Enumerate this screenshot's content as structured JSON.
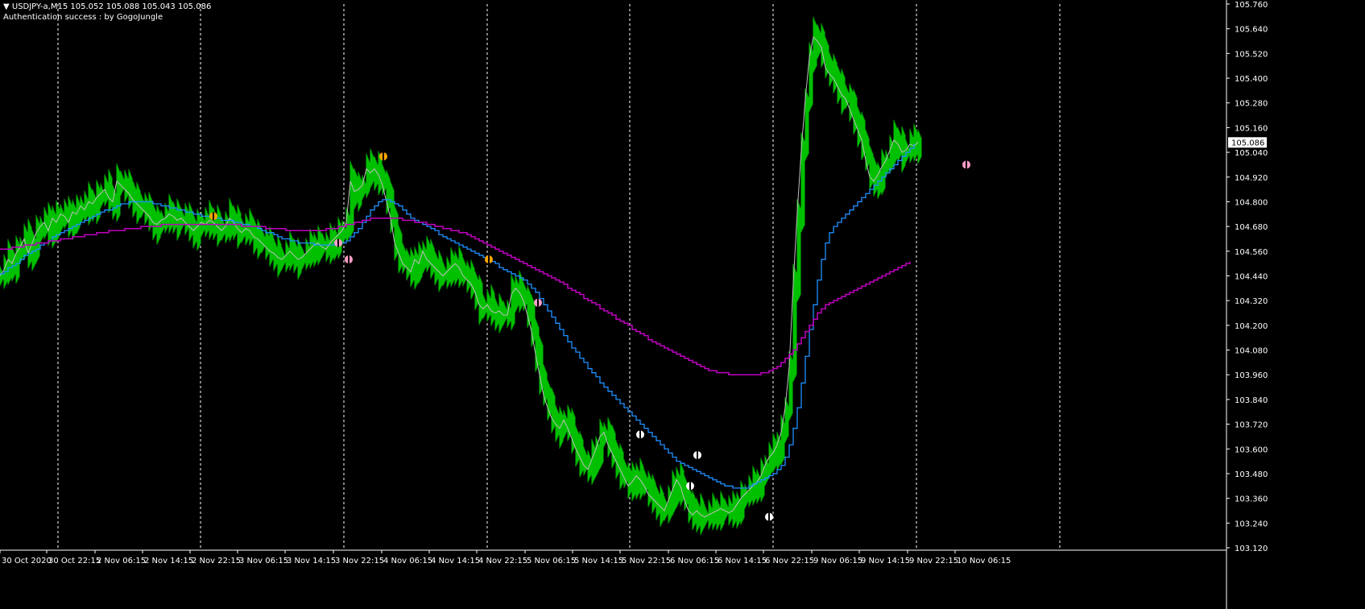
{
  "header": {
    "symbol_line": "▼ USDJPY-a,M15  105.052 105.088 105.043 105.086",
    "auth_line": "Authentication success : by GogoJungle"
  },
  "colors": {
    "background": "#000000",
    "price_bars": "#00c000",
    "ma_fast": "#c0c0c0",
    "ma_mid": "#1e90ff",
    "ma_slow": "#c000c0",
    "axis": "#ffffff",
    "signal_orange": "#ffa500",
    "signal_pink": "#ff9ec8",
    "signal_white": "#ffffff"
  },
  "chart_data": {
    "type": "line",
    "ylim": [
      103.12,
      105.76
    ],
    "y_ticks": [
      "105.760",
      "105.640",
      "105.520",
      "105.400",
      "105.280",
      "105.160",
      "105.040",
      "104.920",
      "104.800",
      "104.680",
      "104.560",
      "104.440",
      "104.320",
      "104.200",
      "104.080",
      "103.960",
      "103.840",
      "103.720",
      "103.600",
      "103.480",
      "103.360",
      "103.240",
      "103.120"
    ],
    "current_price": "105.086",
    "x_ticks": [
      "30 Oct 2020",
      "30 Oct 22:15",
      "2 Nov 06:15",
      "2 Nov 14:15",
      "2 Nov 22:15",
      "3 Nov 06:15",
      "3 Nov 14:15",
      "3 Nov 22:15",
      "4 Nov 06:15",
      "4 Nov 14:15",
      "4 Nov 22:15",
      "5 Nov 06:15",
      "5 Nov 14:15",
      "5 Nov 22:15",
      "6 Nov 06:15",
      "6 Nov 14:15",
      "6 Nov 22:15",
      "9 Nov 06:15",
      "9 Nov 14:15",
      "9 Nov 22:15",
      "10 Nov 06:15"
    ],
    "x": [
      0,
      5,
      10,
      15,
      20,
      25,
      30,
      35,
      40,
      45,
      50,
      55,
      60,
      65,
      70,
      75,
      80,
      85,
      90,
      95,
      100,
      105,
      110,
      115,
      120,
      125,
      130,
      135,
      140,
      145,
      150,
      155,
      160,
      165,
      170,
      175,
      180,
      185,
      190,
      195,
      200,
      205,
      210,
      215,
      220,
      225,
      230,
      235,
      240,
      245,
      250,
      255,
      260,
      265,
      270,
      275,
      280,
      285,
      290,
      295,
      300,
      305,
      310,
      315,
      320,
      325,
      330,
      335,
      340,
      345,
      350,
      355,
      360,
      365,
      370,
      375,
      380,
      385,
      390,
      395,
      400,
      405,
      410,
      415,
      420,
      425,
      430,
      435,
      440,
      445,
      450,
      455,
      460,
      465,
      470,
      475,
      480,
      485,
      490,
      495,
      500,
      505,
      510,
      515,
      520,
      525,
      530,
      535,
      540,
      545,
      550,
      555,
      560,
      565,
      570,
      575,
      580,
      585,
      590,
      595,
      600,
      605,
      610,
      615,
      620,
      625,
      630,
      635,
      640,
      645,
      650,
      655,
      660,
      665,
      670,
      675,
      680,
      685,
      690,
      695,
      700,
      705,
      710,
      715,
      720,
      725,
      730,
      735,
      740,
      745,
      750,
      755,
      760,
      765,
      770,
      775,
      780,
      785,
      790,
      795,
      800,
      805,
      810,
      815,
      820,
      825,
      830,
      835,
      840,
      845,
      850,
      855,
      860,
      865,
      870,
      875,
      880,
      885,
      890,
      895,
      900,
      905,
      910,
      915,
      920,
      925,
      930,
      935,
      940,
      945,
      950,
      955,
      960,
      965,
      970,
      975,
      980,
      985,
      990,
      995,
      1000,
      1005,
      1010,
      1015,
      1020,
      1025,
      1030,
      1035,
      1040,
      1045,
      1050,
      1055,
      1060,
      1065,
      1070,
      1075,
      1080,
      1085,
      1090,
      1095,
      1100,
      1105,
      1110,
      1115,
      1120,
      1125,
      1130,
      1135,
      1140,
      1145,
      1150,
      1155,
      1160,
      1165,
      1170,
      1175,
      1180,
      1185,
      1190,
      1195,
      1200,
      1205,
      1210,
      1215
    ],
    "series": [
      {
        "values": [
          104.44,
          104.47,
          104.52,
          104.5,
          104.55,
          104.58,
          104.62,
          104.55,
          104.6,
          104.65,
          104.68,
          104.7,
          104.66,
          104.72,
          104.7,
          104.74,
          104.73,
          104.7,
          104.75,
          104.74,
          104.78,
          104.76,
          104.8,
          104.79,
          104.82,
          104.84,
          104.86,
          104.82,
          104.8,
          104.9,
          104.88,
          104.86,
          104.84,
          104.81,
          104.79,
          104.77,
          104.75,
          104.73,
          104.7,
          104.69,
          104.71,
          104.72,
          104.74,
          104.73,
          104.71,
          104.72,
          104.7,
          104.68,
          104.66,
          104.68,
          104.7,
          104.69,
          104.71,
          104.7,
          104.68,
          104.66,
          104.68,
          104.72,
          104.7,
          104.67,
          104.65,
          104.67,
          104.66,
          104.63,
          104.62,
          104.6,
          104.58,
          104.56,
          104.55,
          104.53,
          104.52,
          104.54,
          104.56,
          104.54,
          104.52,
          104.53,
          104.55,
          104.57,
          104.59,
          104.6,
          104.58,
          104.57,
          104.6,
          104.62,
          104.64,
          104.66,
          104.7,
          104.9,
          104.85,
          104.86,
          104.88,
          104.96,
          104.94,
          104.96,
          104.93,
          104.88,
          104.8,
          104.72,
          104.6,
          104.55,
          104.5,
          104.48,
          104.46,
          104.52,
          104.5,
          104.56,
          104.52,
          104.5,
          104.48,
          104.46,
          104.44,
          104.46,
          104.48,
          104.5,
          104.48,
          104.44,
          104.42,
          104.4,
          104.36,
          104.3,
          104.28,
          104.3,
          104.27,
          104.26,
          104.27,
          104.25,
          104.25,
          104.35,
          104.38,
          104.36,
          104.32,
          104.25,
          104.17,
          104.06,
          103.96,
          103.86,
          103.8,
          103.75,
          103.72,
          103.7,
          103.74,
          103.7,
          103.65,
          103.6,
          103.56,
          103.52,
          103.5,
          103.55,
          103.6,
          103.66,
          103.68,
          103.62,
          103.58,
          103.54,
          103.5,
          103.46,
          103.42,
          103.44,
          103.47,
          103.45,
          103.42,
          103.38,
          103.36,
          103.34,
          103.32,
          103.3,
          103.35,
          103.4,
          103.45,
          103.42,
          103.35,
          103.3,
          103.28,
          103.3,
          103.28,
          103.27,
          103.28,
          103.29,
          103.3,
          103.31,
          103.3,
          103.29,
          103.3,
          103.33,
          103.36,
          103.38,
          103.4,
          103.42,
          103.44,
          103.47,
          103.52,
          103.56,
          103.58,
          103.62,
          103.68,
          103.8,
          104.0,
          104.4,
          104.75,
          105.05,
          105.3,
          105.5,
          105.6,
          105.58,
          105.55,
          105.45,
          105.42,
          105.4,
          105.36,
          105.32,
          105.3,
          105.25,
          105.2,
          105.15,
          105.1,
          105.0,
          104.92,
          104.9,
          104.93,
          104.97,
          105.0,
          105.05,
          105.1,
          105.08,
          105.04,
          105.05,
          105.08,
          105.07,
          105.09
        ]
      },
      {
        "values": [
          104.45,
          104.46,
          104.48,
          104.49,
          104.5,
          104.52,
          104.54,
          104.55,
          104.56,
          104.57,
          104.59,
          104.6,
          104.61,
          104.63,
          104.64,
          104.65,
          104.66,
          104.67,
          104.68,
          104.69,
          104.7,
          104.71,
          104.72,
          104.73,
          104.74,
          104.75,
          104.76,
          104.76,
          104.77,
          104.78,
          104.79,
          104.79,
          104.8,
          104.8,
          104.8,
          104.8,
          104.8,
          104.8,
          104.79,
          104.79,
          104.78,
          104.78,
          104.77,
          104.77,
          104.76,
          104.76,
          104.75,
          104.75,
          104.74,
          104.74,
          104.73,
          104.73,
          104.73,
          104.72,
          104.72,
          104.71,
          104.71,
          104.71,
          104.7,
          104.7,
          104.69,
          104.69,
          104.68,
          104.68,
          104.67,
          104.66,
          104.65,
          104.65,
          104.64,
          104.63,
          104.62,
          104.62,
          104.61,
          104.61,
          104.6,
          104.6,
          104.6,
          104.6,
          104.59,
          104.59,
          104.59,
          104.59,
          104.59,
          104.6,
          104.6,
          104.6,
          104.61,
          104.63,
          104.65,
          104.67,
          104.7,
          104.73,
          104.76,
          104.78,
          104.8,
          104.81,
          104.81,
          104.8,
          104.79,
          104.78,
          104.76,
          104.74,
          104.72,
          104.71,
          104.7,
          104.69,
          104.68,
          104.67,
          104.66,
          104.64,
          104.63,
          104.62,
          104.61,
          104.6,
          104.59,
          104.58,
          104.57,
          104.56,
          104.55,
          104.54,
          104.53,
          104.52,
          104.51,
          104.5,
          104.48,
          104.47,
          104.46,
          104.45,
          104.44,
          104.43,
          104.42,
          104.4,
          104.38,
          104.36,
          104.33,
          104.3,
          104.27,
          104.24,
          104.21,
          104.18,
          104.15,
          104.12,
          104.09,
          104.07,
          104.04,
          104.02,
          103.99,
          103.97,
          103.95,
          103.92,
          103.9,
          103.88,
          103.86,
          103.84,
          103.82,
          103.8,
          103.78,
          103.76,
          103.74,
          103.72,
          103.7,
          103.68,
          103.66,
          103.64,
          103.62,
          103.6,
          103.58,
          103.56,
          103.54,
          103.53,
          103.52,
          103.51,
          103.5,
          103.49,
          103.48,
          103.47,
          103.46,
          103.45,
          103.44,
          103.43,
          103.42,
          103.42,
          103.41,
          103.41,
          103.41,
          103.41,
          103.42,
          103.43,
          103.44,
          103.45,
          103.46,
          103.47,
          103.48,
          103.5,
          103.52,
          103.56,
          103.62,
          103.7,
          103.8,
          103.92,
          104.05,
          104.18,
          104.3,
          104.42,
          104.52,
          104.6,
          104.65,
          104.68,
          104.7,
          104.72,
          104.74,
          104.76,
          104.78,
          104.8,
          104.82,
          104.84,
          104.86,
          104.88,
          104.9,
          104.92,
          104.94,
          104.96,
          104.98,
          105.0,
          105.02,
          105.04,
          105.06,
          105.08
        ]
      },
      {
        "values": [
          104.57,
          104.57,
          104.57,
          104.58,
          104.58,
          104.58,
          104.59,
          104.59,
          104.59,
          104.6,
          104.6,
          104.6,
          104.61,
          104.61,
          104.61,
          104.62,
          104.62,
          104.62,
          104.63,
          104.63,
          104.63,
          104.64,
          104.64,
          104.64,
          104.65,
          104.65,
          104.65,
          104.66,
          104.66,
          104.66,
          104.66,
          104.67,
          104.67,
          104.67,
          104.67,
          104.68,
          104.68,
          104.68,
          104.68,
          104.68,
          104.69,
          104.69,
          104.69,
          104.69,
          104.69,
          104.69,
          104.69,
          104.69,
          104.69,
          104.69,
          104.69,
          104.69,
          104.69,
          104.69,
          104.69,
          104.69,
          104.69,
          104.69,
          104.69,
          104.69,
          104.68,
          104.68,
          104.68,
          104.68,
          104.68,
          104.68,
          104.67,
          104.67,
          104.67,
          104.67,
          104.67,
          104.66,
          104.66,
          104.66,
          104.66,
          104.66,
          104.66,
          104.66,
          104.66,
          104.66,
          104.66,
          104.67,
          104.67,
          104.67,
          104.68,
          104.68,
          104.69,
          104.69,
          104.7,
          104.7,
          104.71,
          104.71,
          104.72,
          104.72,
          104.72,
          104.72,
          104.72,
          104.72,
          104.72,
          104.72,
          104.71,
          104.71,
          104.71,
          104.7,
          104.7,
          104.7,
          104.69,
          104.69,
          104.68,
          104.68,
          104.67,
          104.67,
          104.66,
          104.66,
          104.65,
          104.65,
          104.64,
          104.63,
          104.62,
          104.61,
          104.6,
          104.59,
          104.58,
          104.57,
          104.56,
          104.55,
          104.54,
          104.53,
          104.52,
          104.51,
          104.5,
          104.49,
          104.48,
          104.47,
          104.46,
          104.45,
          104.44,
          104.43,
          104.42,
          104.41,
          104.4,
          104.38,
          104.37,
          104.36,
          104.35,
          104.33,
          104.32,
          104.31,
          104.3,
          104.28,
          104.27,
          104.26,
          104.25,
          104.23,
          104.22,
          104.21,
          104.2,
          104.18,
          104.17,
          104.16,
          104.15,
          104.13,
          104.12,
          104.11,
          104.1,
          104.09,
          104.08,
          104.07,
          104.06,
          104.05,
          104.04,
          104.03,
          104.02,
          104.01,
          104.0,
          103.99,
          103.98,
          103.98,
          103.97,
          103.97,
          103.97,
          103.96,
          103.96,
          103.96,
          103.96,
          103.96,
          103.96,
          103.96,
          103.96,
          103.97,
          103.97,
          103.98,
          103.99,
          104.0,
          104.02,
          104.04,
          104.06,
          104.08,
          104.11,
          104.14,
          104.17,
          104.2,
          104.23,
          104.26,
          104.28,
          104.3,
          104.31,
          104.32,
          104.33,
          104.34,
          104.35,
          104.36,
          104.37,
          104.38,
          104.39,
          104.4,
          104.41,
          104.42,
          104.43,
          104.44,
          104.45,
          104.46,
          104.47,
          104.48,
          104.49,
          104.5,
          104.51
        ]
      }
    ],
    "signals": [
      {
        "x": 265,
        "y": 104.73,
        "kind": "orange"
      },
      {
        "x": 420,
        "y": 104.6,
        "kind": "pink"
      },
      {
        "x": 433,
        "y": 104.52,
        "kind": "pink"
      },
      {
        "x": 476,
        "y": 105.02,
        "kind": "orange"
      },
      {
        "x": 607,
        "y": 104.52,
        "kind": "orange"
      },
      {
        "x": 668,
        "y": 104.31,
        "kind": "pink"
      },
      {
        "x": 795,
        "y": 103.67,
        "kind": "white"
      },
      {
        "x": 857,
        "y": 103.42,
        "kind": "white"
      },
      {
        "x": 866,
        "y": 103.57,
        "kind": "white"
      },
      {
        "x": 955,
        "y": 103.27,
        "kind": "white"
      },
      {
        "x": 1200,
        "y": 104.98,
        "kind": "pink"
      }
    ]
  }
}
